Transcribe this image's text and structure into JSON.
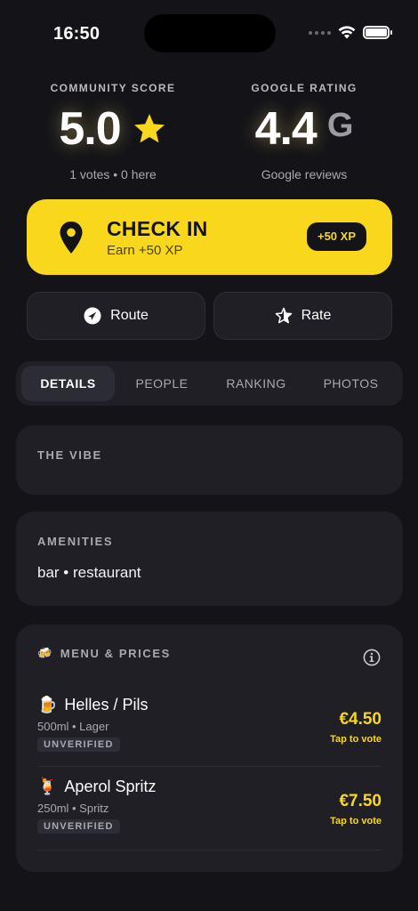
{
  "status_bar": {
    "time": "16:50"
  },
  "scores": {
    "community": {
      "label": "COMMUNITY SCORE",
      "value": "5.0",
      "sub": "1 votes • 0 here"
    },
    "google": {
      "label": "GOOGLE RATING",
      "value": "4.4",
      "logo": "G",
      "sub": "Google reviews"
    }
  },
  "checkin": {
    "title": "CHECK IN",
    "subtitle": "Earn +50 XP",
    "badge": "+50 XP"
  },
  "actions": {
    "route_label": "Route",
    "rate_label": "Rate"
  },
  "tabs": [
    {
      "label": "DETAILS",
      "active": true
    },
    {
      "label": "PEOPLE",
      "active": false
    },
    {
      "label": "RANKING",
      "active": false
    },
    {
      "label": "PHOTOS",
      "active": false
    }
  ],
  "vibe": {
    "title": "THE VIBE"
  },
  "amenities": {
    "title": "AMENITIES",
    "text": "bar • restaurant"
  },
  "menu": {
    "title": "MENU & PRICES",
    "title_icon": "🍻",
    "items": [
      {
        "emoji": "🍺",
        "name": "Helles / Pils",
        "detail": "500ml • Lager",
        "badge": "UNVERIFIED",
        "price": "€4.50",
        "price_sub": "Tap to vote"
      },
      {
        "emoji": "🍹",
        "name": "Aperol Spritz",
        "detail": "250ml • Spritz",
        "badge": "UNVERIFIED",
        "price": "€7.50",
        "price_sub": "Tap to vote"
      }
    ]
  },
  "colors": {
    "accent": "#f9d71c",
    "background": "#141418",
    "card": "#1f1f25"
  }
}
